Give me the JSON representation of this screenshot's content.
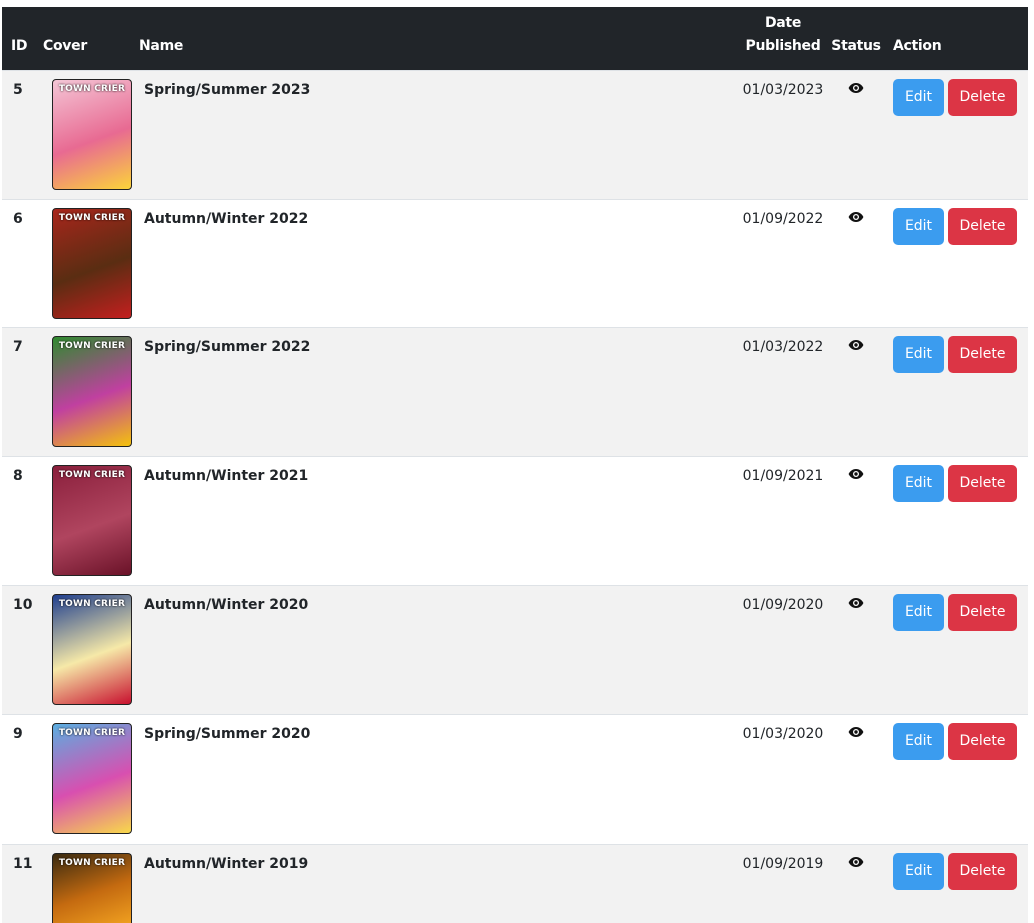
{
  "table": {
    "headers": {
      "id": "ID",
      "cover": "Cover",
      "name": "Name",
      "date_line1": "Date",
      "date_line2": "Published",
      "status": "Status",
      "action": "Action"
    },
    "rows": [
      {
        "id": "5",
        "name": "Spring/Summer 2023",
        "date": "01/03/2023",
        "status_icon": "eye-icon",
        "edit": "Edit",
        "delete": "Delete",
        "cover_colors": [
          "#f4c6d6",
          "#e86a92",
          "#fbd43a"
        ],
        "cover_title": "TOWN CRIER"
      },
      {
        "id": "6",
        "name": "Autumn/Winter 2022",
        "date": "01/09/2022",
        "status_icon": "eye-icon",
        "edit": "Edit",
        "delete": "Delete",
        "cover_colors": [
          "#a8261c",
          "#5a2d12",
          "#c41f1f"
        ],
        "cover_title": "TOWN CRIER"
      },
      {
        "id": "7",
        "name": "Spring/Summer 2022",
        "date": "01/03/2022",
        "status_icon": "eye-icon",
        "edit": "Edit",
        "delete": "Delete",
        "cover_colors": [
          "#2e8b2e",
          "#c040a0",
          "#f4c20d"
        ],
        "cover_title": "TOWN CRIER"
      },
      {
        "id": "8",
        "name": "Autumn/Winter 2021",
        "date": "01/09/2021",
        "status_icon": "eye-icon",
        "edit": "Edit",
        "delete": "Delete",
        "cover_colors": [
          "#8a1f3c",
          "#b0455f",
          "#6a1228"
        ],
        "cover_title": "TOWN CRIER"
      },
      {
        "id": "10",
        "name": "Autumn/Winter 2020",
        "date": "01/09/2020",
        "status_icon": "eye-icon",
        "edit": "Edit",
        "delete": "Delete",
        "cover_colors": [
          "#1f3f8f",
          "#f6e9a8",
          "#c8102e"
        ],
        "cover_title": "TOWN CRIER"
      },
      {
        "id": "9",
        "name": "Spring/Summer 2020",
        "date": "01/03/2020",
        "status_icon": "eye-icon",
        "edit": "Edit",
        "delete": "Delete",
        "cover_colors": [
          "#5aaee0",
          "#d84fb0",
          "#f8d94a"
        ],
        "cover_title": "TOWN CRIER"
      },
      {
        "id": "11",
        "name": "Autumn/Winter 2019",
        "date": "01/09/2019",
        "status_icon": "eye-icon",
        "edit": "Edit",
        "delete": "Delete",
        "cover_colors": [
          "#3a2a10",
          "#c46a10",
          "#f0a020"
        ],
        "cover_title": "TOWN CRIER"
      }
    ]
  }
}
